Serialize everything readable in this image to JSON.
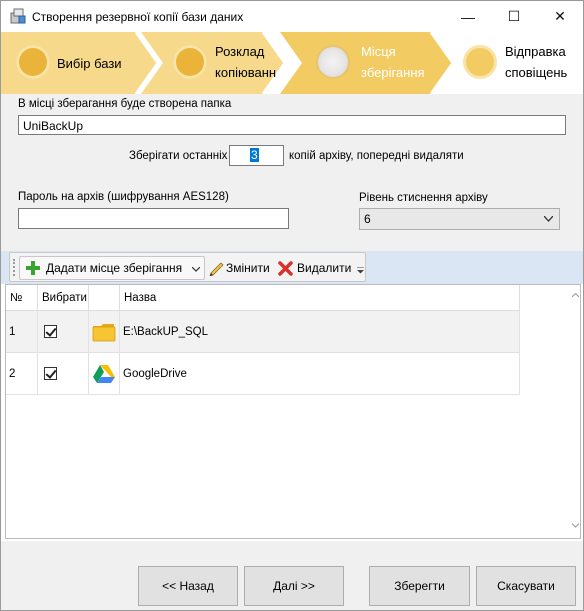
{
  "window": {
    "title": "Створення резервної копії бази даних",
    "minimize": "—",
    "maximize": "☐",
    "close": "✕"
  },
  "steps": [
    {
      "label_line1": "Вибір бази",
      "label_line2": "",
      "state": "done"
    },
    {
      "label_line1": "Розклад",
      "label_line2": "копіюванні",
      "state": "done"
    },
    {
      "label_line1": "Місця",
      "label_line2": "зберігання",
      "state": "active"
    },
    {
      "label_line1": "Відправка",
      "label_line2": "сповіщень",
      "state": "pending"
    }
  ],
  "form": {
    "folder_label": "В місці зберагання буде створена папка",
    "folder_value": "UniBackUp",
    "keep_prefix": "Зберігати останніх",
    "keep_value": "3",
    "keep_suffix": "копій архіву, попередні видаляти",
    "password_label": "Пароль на архів (шифрування AES128)",
    "password_value": "",
    "compression_label": "Рівень стиснення архіву",
    "compression_value": "6"
  },
  "toolbar": {
    "add_label": "Дадати місце зберігання",
    "edit_label": "Змінити",
    "delete_label": "Видалити"
  },
  "table": {
    "columns": [
      "№",
      "Вибрати",
      "",
      "Назва"
    ],
    "rows": [
      {
        "num": "1",
        "checked": true,
        "icon": "folder-icon",
        "name": "E:\\BackUP_SQL"
      },
      {
        "num": "2",
        "checked": true,
        "icon": "google-drive-icon",
        "name": "GoogleDrive"
      }
    ]
  },
  "buttons": {
    "back": "<< Назад",
    "next": "Далі >>",
    "save": "Зберегти",
    "cancel": "Скасувати"
  },
  "colors": {
    "step_done": "#f6d98a",
    "step_active": "#f3cb63",
    "circle_done": "#eab43a",
    "selection_row": "#f2f2f2",
    "toolbar_band": "#dae6f4",
    "form_bg": "#f0f0f0"
  }
}
